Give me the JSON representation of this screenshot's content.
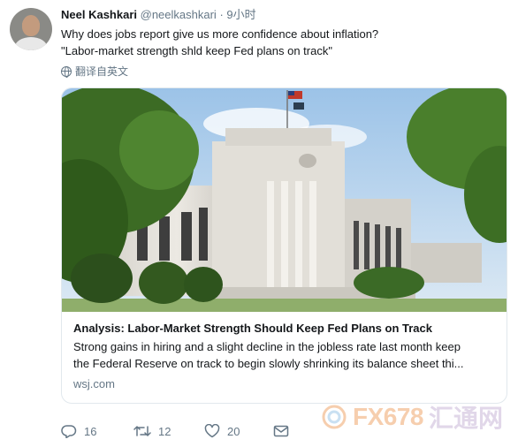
{
  "tweet": {
    "author_name": "Neel Kashkari",
    "author_handle": "@neelkashkari",
    "separator": "·",
    "time": "9小时",
    "text_line1": "Why does jobs report give us more confidence about inflation?",
    "text_line2": "\"Labor-market strength shld keep Fed plans on track\"",
    "translate_label": "翻译自英文",
    "translate_icon": "globe-icon"
  },
  "card": {
    "image_icon": "federal-reserve-building-photo",
    "title": "Analysis: Labor-Market Strength Should Keep Fed Plans on Track",
    "desc_line1": "Strong gains in hiring and a slight decline in the jobless rate last month keep",
    "desc_line2": "the Federal Reserve on track to begin slowly shrinking its balance sheet thi...",
    "domain": "wsj.com"
  },
  "actions": {
    "reply_icon": "reply-icon",
    "reply_count": "16",
    "retweet_icon": "retweet-icon",
    "retweet_count": "12",
    "like_icon": "heart-icon",
    "like_count": "20",
    "dm_icon": "envelope-icon"
  },
  "watermark": {
    "latin": "FX678",
    "chinese": "汇通网"
  },
  "colors": {
    "text": "#14171a",
    "secondary": "#657786",
    "border": "#e1e8ed",
    "watermark_orange": "#f0a76c"
  }
}
